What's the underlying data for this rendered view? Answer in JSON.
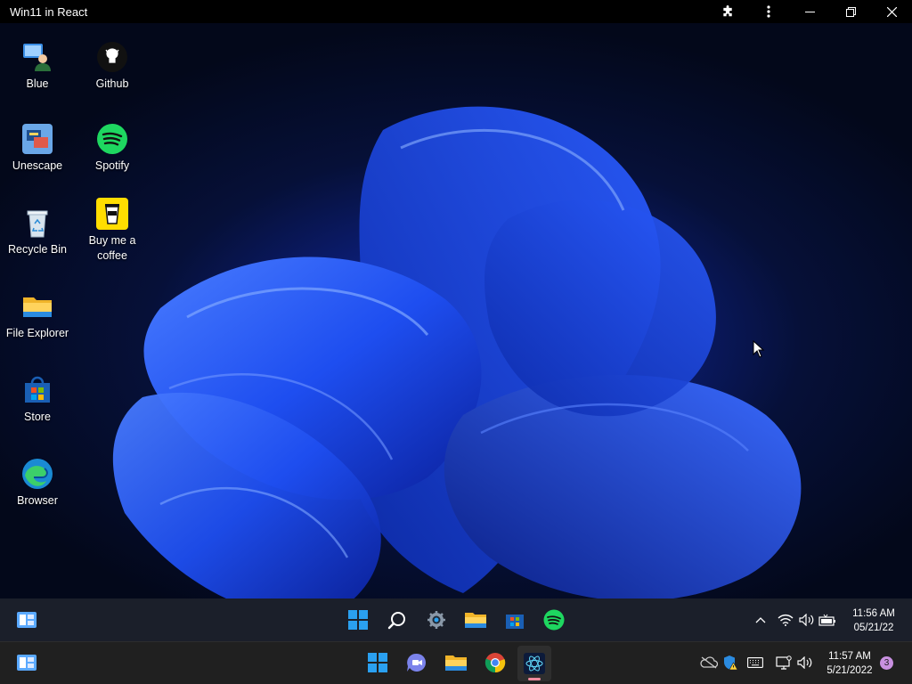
{
  "window": {
    "title": "Win11 in React"
  },
  "desktop_icons": [
    {
      "label": "Blue",
      "icon": "blue-person-icon"
    },
    {
      "label": "Github",
      "icon": "github-icon"
    },
    {
      "label": "Unescape",
      "icon": "unescape-icon"
    },
    {
      "label": "Spotify",
      "icon": "spotify-icon"
    },
    {
      "label": "Recycle Bin",
      "icon": "recycle-bin-icon"
    },
    {
      "label": "Buy me a coffee",
      "icon": "coffee-icon"
    },
    {
      "label": "File Explorer",
      "icon": "folder-icon"
    },
    {
      "label": "Store",
      "icon": "store-icon"
    },
    {
      "label": "Browser",
      "icon": "edge-icon"
    }
  ],
  "inner_taskbar": {
    "apps": [
      "widgets-icon",
      "start-icon",
      "search-icon",
      "settings-icon",
      "folder-icon",
      "store-icon",
      "spotify-icon"
    ],
    "tray": [
      "chevron-up-icon",
      "wifi-icon",
      "volume-icon",
      "battery-icon"
    ],
    "time": "11:56 AM",
    "date": "05/21/22"
  },
  "host_taskbar": {
    "apps": [
      "widgets-icon",
      "start-icon",
      "teams-chat-icon",
      "folder-icon",
      "chrome-icon",
      "win11-react-app-icon"
    ],
    "tray": [
      "onedrive-off-icon",
      "defender-warning-icon",
      "keyboard-icon",
      "display-icon",
      "volume-icon"
    ],
    "time": "11:57 AM",
    "date": "5/21/2022",
    "notification_count": "3"
  },
  "colors": {
    "accent": "#0078d4",
    "spotify": "#1ed760",
    "taskbar": "#202020"
  }
}
